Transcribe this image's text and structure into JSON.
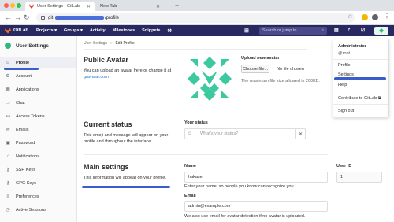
{
  "browser": {
    "active_tab_title": "User Settings · GitLab",
    "inactive_tab_title": "New Tab",
    "url_prefix": "git.",
    "url_suffix": "/profile"
  },
  "gitlab_nav": {
    "brand": "GitLab",
    "items": [
      "Projects ▾",
      "Groups ▾",
      "Activity",
      "Milestones",
      "Snippets"
    ],
    "search_placeholder": "Search or jump to..."
  },
  "sidebar": {
    "header": "User Settings",
    "items": [
      {
        "label": "Profile",
        "icon": "person-icon",
        "glyph": "☺",
        "active": true
      },
      {
        "label": "Account",
        "icon": "account-icon",
        "glyph": "⚙"
      },
      {
        "label": "Applications",
        "icon": "applications-icon",
        "glyph": "▦"
      },
      {
        "label": "Chat",
        "icon": "chat-icon",
        "glyph": "▭"
      },
      {
        "label": "Access Tokens",
        "icon": "token-icon",
        "glyph": "⊶"
      },
      {
        "label": "Emails",
        "icon": "email-icon",
        "glyph": "✉"
      },
      {
        "label": "Password",
        "icon": "lock-icon",
        "glyph": "▣"
      },
      {
        "label": "Notifications",
        "icon": "bell-icon",
        "glyph": "♫"
      },
      {
        "label": "SSH Keys",
        "icon": "key-icon",
        "glyph": "⚷"
      },
      {
        "label": "GPG Keys",
        "icon": "gpg-key-icon",
        "glyph": "⚷"
      },
      {
        "label": "Preferences",
        "icon": "preferences-icon",
        "glyph": "≡"
      },
      {
        "label": "Active Sessions",
        "icon": "sessions-icon",
        "glyph": "◷"
      }
    ]
  },
  "breadcrumb": {
    "parent": "User Settings",
    "separator": "›",
    "current": "Edit Profile"
  },
  "public_avatar": {
    "title": "Public Avatar",
    "desc": "You can upload an avatar here or change it at",
    "link": "gravatar.com",
    "upload_label": "Upload new avatar",
    "choose_button": "Choose file...",
    "no_file": "No file chosen",
    "max_size": "The maximum file size allowed is 200KB."
  },
  "current_status": {
    "title": "Current status",
    "desc_line1": "This emoji and message will appear on your",
    "desc_line2": "profile and throughout the interface.",
    "field_label": "Your status",
    "placeholder": "What's your status?"
  },
  "main_settings": {
    "title": "Main settings",
    "desc": "This information will appear on your profile.",
    "name_label": "Name",
    "name_value": "hakase",
    "name_hint": "Enter your name, so people you know can recognize you.",
    "userid_label": "User ID",
    "userid_value": "1",
    "email_label": "Email",
    "email_value": "admin@example.com",
    "email_hint": "We also use email for avatar detection if no avatar is uploaded."
  },
  "user_dropdown": {
    "name": "Administrator",
    "username": "@root",
    "items": [
      "Profile",
      "Settings",
      "Help",
      "Contribute to GitLab",
      "Sign out"
    ]
  },
  "colors": {
    "nav_bg": "#292961",
    "accent_blue": "#3b5dcc",
    "avatar_green": "#2eb67d"
  }
}
